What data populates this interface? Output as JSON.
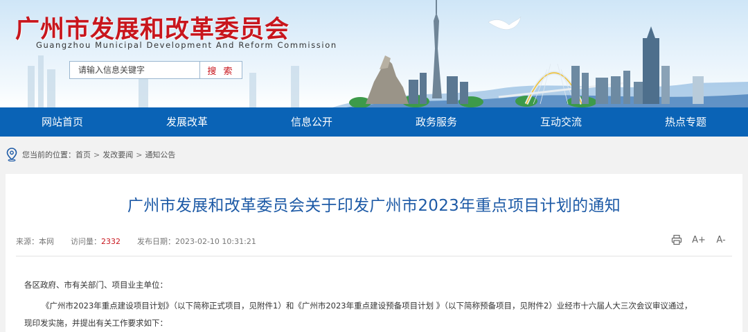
{
  "header": {
    "title": "广州市发展和改革委员会",
    "subtitle": "Guangzhou Municipal Development And Reform Commission",
    "search_placeholder": "请输入信息关键字",
    "search_button": "搜 索"
  },
  "nav": {
    "items": [
      "网站首页",
      "发展改革",
      "信息公开",
      "政务服务",
      "互动交流",
      "热点专题"
    ]
  },
  "breadcrumb": {
    "prefix": "您当前的位置：",
    "items": [
      "首页",
      "发改要闻",
      "通知公告"
    ],
    "separator": ">"
  },
  "article": {
    "title": "广州市发展和改革委员会关于印发广州市2023年重点项目计划的通知",
    "source_label": "来源：",
    "source_value": "本网",
    "views_label": "访问量：",
    "views_value": "2332",
    "date_label": "发布日期：",
    "date_value": "2023-02-10 10:31:21",
    "tools": {
      "print": "print-icon",
      "font_up": "A+",
      "font_down": "A-"
    },
    "paragraph_1": "各区政府、市有关部门、项目业主单位：",
    "paragraph_2": "《广州市2023年重点建设项目计划》（以下简称正式项目，见附件1）和《广州市2023年重点建设预备项目计划 》（以下简称预备项目，见附件2）业经市十六届人大三次会议审议通过，",
    "paragraph_3": "现印发实施，并提出有关工作要求如下："
  },
  "colors": {
    "brand_red": "#c8161d",
    "nav_blue": "#0a63b6",
    "title_blue": "#1d5aa6"
  }
}
